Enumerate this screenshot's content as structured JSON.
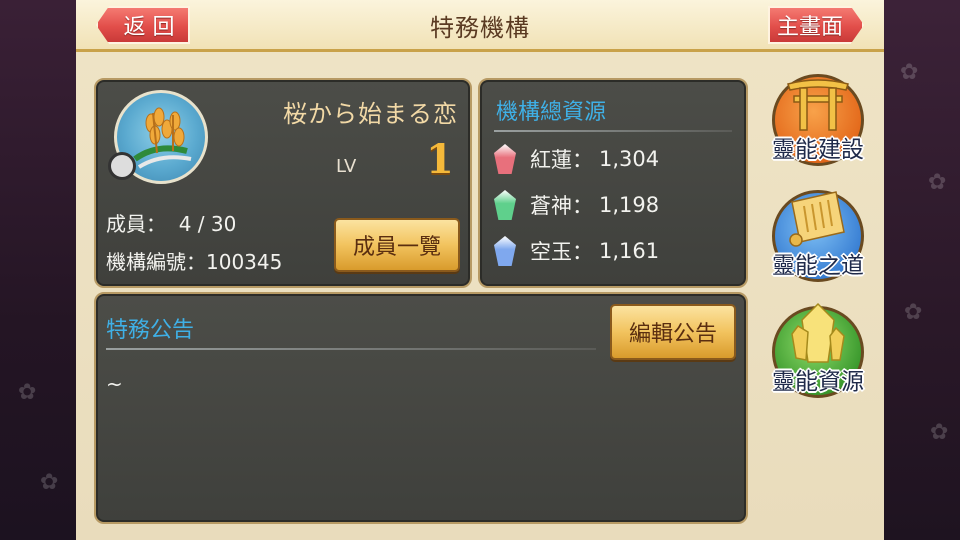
{
  "header": {
    "title": "特務機構",
    "back_label": "返 回",
    "home_label": "主畫面"
  },
  "guild": {
    "name": "桜から始まる恋",
    "lv_label": "LV",
    "lv_value": "1",
    "members_text": "成員：  4 / 30",
    "guild_no_text": "機構編號：100345",
    "members_button": "成員一覽"
  },
  "resources": {
    "title": "機構總資源",
    "items": [
      {
        "name": "紅蓮：",
        "value": "1,304",
        "color": "#e8707c"
      },
      {
        "name": "蒼神：",
        "value": "1,198",
        "color": "#5fd08c"
      },
      {
        "name": "空玉：",
        "value": "1,161",
        "color": "#7fa8ee"
      }
    ]
  },
  "notice": {
    "title": "特務公告",
    "edit_button": "編輯公告",
    "content": "~"
  },
  "side_menu": [
    {
      "label": "靈能建設",
      "icon": "torii-gate-icon",
      "color": "#e9732a"
    },
    {
      "label": "靈能之道",
      "icon": "scroll-icon",
      "color": "#3f86d8"
    },
    {
      "label": "靈能資源",
      "icon": "crystal-icon",
      "color": "#46a83a"
    }
  ]
}
